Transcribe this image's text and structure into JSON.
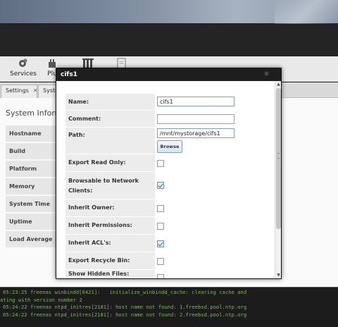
{
  "toolbar": {
    "items": [
      {
        "label": "Services",
        "icon": "gear-cluster-icon"
      },
      {
        "label": "Plu",
        "icon": "plugin-icon"
      },
      {
        "label": "",
        "icon": "columns-icon"
      },
      {
        "label": "",
        "icon": "document-icon"
      }
    ]
  },
  "tabs": [
    {
      "label": "Settings",
      "close": "✕"
    },
    {
      "label": "Syste"
    }
  ],
  "background": {
    "title": "System Inform",
    "rows": [
      "Hostname",
      "Build",
      "Platform",
      "Memory",
      "System Time",
      "Uptime",
      "Load Average"
    ]
  },
  "dialog": {
    "title": "cifs1",
    "fields": {
      "name": {
        "label": "Name:",
        "value": "cifs1"
      },
      "comment": {
        "label": "Comment:",
        "value": ""
      },
      "path": {
        "label": "Path:",
        "value": "/mnt/mystorage/cifs1",
        "browse_label": "Browse"
      },
      "export_read_only": {
        "label": "Export Read Only:",
        "checked": false
      },
      "browsable": {
        "label": "Browsable to Network Clients:",
        "checked": true
      },
      "inherit_owner": {
        "label": "Inherit Owner:",
        "checked": false
      },
      "inherit_permissions": {
        "label": "Inherit Permissions:",
        "checked": false
      },
      "inherit_acls": {
        "label": "Inherit ACL's:",
        "checked": true
      },
      "export_recycle_bin": {
        "label": "Export Recycle Bin:",
        "checked": false
      },
      "show_hidden_files": {
        "label": "Show Hidden Files:",
        "checked": false
      }
    }
  },
  "console": {
    "lines": [
      "05:23:25 freenas winbindd[6421]:   initialize_winbindd_cache: clearing cache and",
      "ating with version number 2",
      "05:24:22 freenas ntpd_initres[2181]: host name not found: 1.freebsd.pool.ntp.org",
      "05:24:22 freenas ntpd_initres[2181]: host name not found: 2.freebsd.pool.ntp.org"
    ]
  }
}
